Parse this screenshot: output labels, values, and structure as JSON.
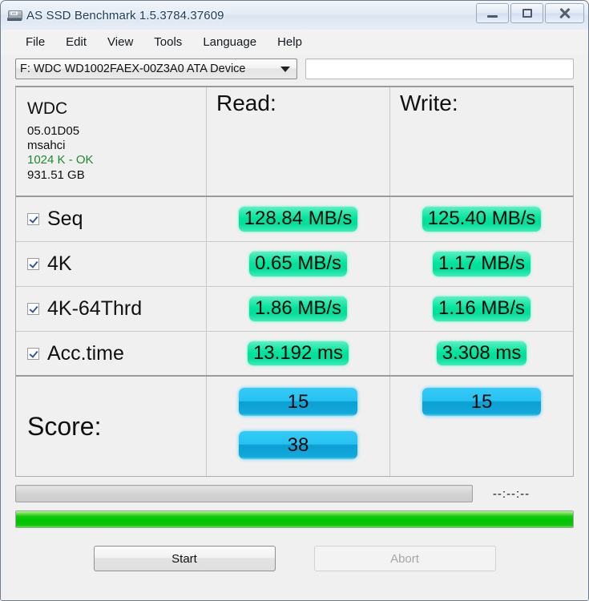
{
  "window": {
    "title": "AS SSD Benchmark 1.5.3784.37609",
    "icon": "hdd-icon",
    "minimize_label": "—",
    "maximize_label": "□",
    "close_label": "✕"
  },
  "menubar": {
    "items": [
      {
        "label": "File"
      },
      {
        "label": "Edit"
      },
      {
        "label": "View"
      },
      {
        "label": "Tools"
      },
      {
        "label": "Language"
      },
      {
        "label": "Help"
      }
    ]
  },
  "selector": {
    "drive_value": "F: WDC WD1002FAEX-00Z3A0 ATA Device",
    "dropdown_icon": "chevron-down-icon",
    "name_field_value": "",
    "name_field_placeholder": ""
  },
  "drive_info": {
    "model": "WDC",
    "firmware": "05.01D05",
    "driver": "msahci",
    "alignment": "1024 K - OK",
    "alignment_color": "#1e8a2e",
    "capacity": "931.51 GB"
  },
  "columns": {
    "read_header": "Read:",
    "write_header": "Write:"
  },
  "tests": [
    {
      "name": "Seq",
      "checked": true,
      "read": "128.84 MB/s",
      "write": "125.40 MB/s"
    },
    {
      "name": "4K",
      "checked": true,
      "read": "0.65 MB/s",
      "write": "1.17 MB/s"
    },
    {
      "name": "4K-64Thrd",
      "checked": true,
      "read": "1.86 MB/s",
      "write": "1.16 MB/s"
    },
    {
      "name": "Acc.time",
      "checked": true,
      "read": "13.192 ms",
      "write": "3.308 ms"
    }
  ],
  "score": {
    "label": "Score:",
    "read": "15",
    "write": "15",
    "total": "38"
  },
  "progress": {
    "task_percent": 0,
    "overall_percent": 100,
    "timer": "--:--:--"
  },
  "buttons": {
    "start": "Start",
    "abort": "Abort"
  },
  "colors": {
    "value_highlight": "#00e39d",
    "score_bar": "#0b9fd2",
    "progress_green": "#00c300",
    "alignment_ok": "#1e8a2e"
  }
}
